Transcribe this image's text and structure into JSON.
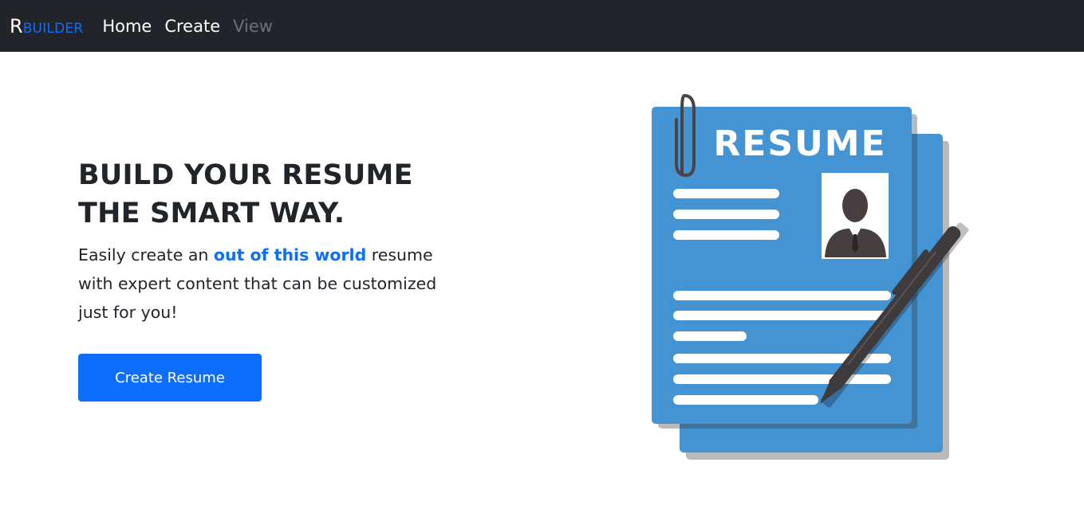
{
  "navbar": {
    "brand_first": "R",
    "brand_rest": "BUILDER",
    "links": [
      {
        "label": "Home",
        "state": "active"
      },
      {
        "label": "Create",
        "state": "active"
      },
      {
        "label": "View",
        "state": "disabled"
      }
    ]
  },
  "hero": {
    "headline_line1": "BUILD YOUR RESUME",
    "headline_line2": "THE SMART WAY.",
    "subtitle_before": "Easily create an ",
    "subtitle_highlight": "out of this world",
    "subtitle_after": " resume with expert content that can be customized just for you!",
    "cta_label": "Create Resume"
  },
  "illustration": {
    "title": "RESUME",
    "icons": [
      "paperclip-icon",
      "person-icon",
      "pen-icon"
    ]
  },
  "colors": {
    "navbar_bg": "#212529",
    "accent": "#0d6efd",
    "resume_blue": "#4493d2",
    "pen": "#3f3a3b"
  }
}
